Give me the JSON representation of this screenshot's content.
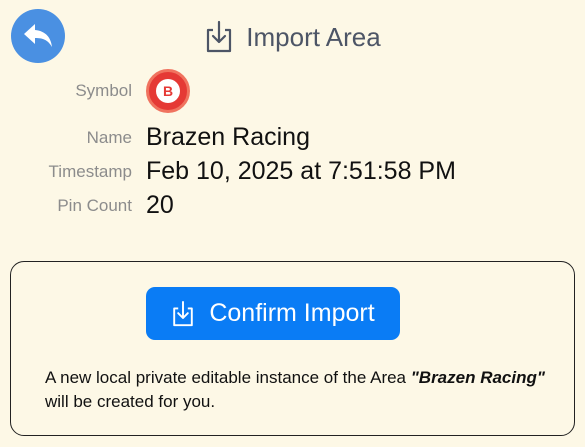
{
  "header": {
    "title": "Import Area"
  },
  "fields": {
    "symbol_label": "Symbol",
    "symbol_letter": "B",
    "name_label": "Name",
    "name_value": "Brazen Racing",
    "timestamp_label": "Timestamp",
    "timestamp_value": "Feb 10, 2025 at 7:51:58 PM",
    "pin_count_label": "Pin Count",
    "pin_count_value": "20"
  },
  "card": {
    "confirm_label": "Confirm Import",
    "note_prefix": "A new local private editable instance of the Area ",
    "note_area_name": "\"Brazen Racing\"",
    "note_suffix": " will be created for you."
  },
  "colors": {
    "background": "#fdf8e6",
    "accent": "#0a7cf5",
    "back_button": "#4a90e2",
    "symbol": "#e53935"
  },
  "icons": {
    "back": "undo-arrow-icon",
    "import": "tray-arrow-down-icon"
  }
}
